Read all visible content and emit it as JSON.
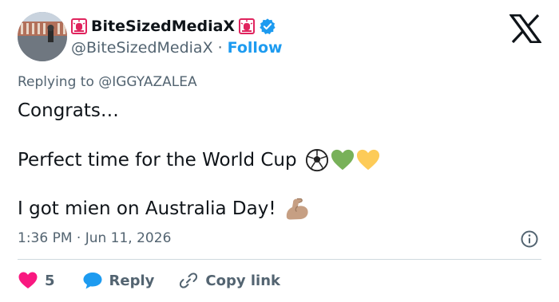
{
  "author": {
    "display_name": "BiteSizedMediaX",
    "handle": "@BiteSizedMediaX",
    "separator": "·",
    "follow_label": "Follow",
    "verified_color": "#1d9bf0"
  },
  "icons": {
    "brand": "x-logo-icon",
    "name_decoration": "siren-icon",
    "verified": "verified-badge-icon",
    "info": "info-icon",
    "like": "heart-icon",
    "reply": "speech-bubble-icon",
    "copy": "link-icon"
  },
  "tweet": {
    "replying_prefix": "Replying to",
    "replying_to": "@IGGYAZALEA",
    "line1": "Congrats…",
    "line2": "Perfect time for the World Cup",
    "line3": "I got mien on Australia Day!",
    "line2_emoji": [
      "soccer-ball",
      "green-heart",
      "yellow-heart"
    ],
    "line3_emoji": [
      "flexed-biceps"
    ],
    "timestamp": "1:36 PM · Jun 11, 2026"
  },
  "actions": {
    "like_count": "5",
    "reply_label": "Reply",
    "copy_label": "Copy link"
  },
  "colors": {
    "text": "#0f1419",
    "secondary": "#536471",
    "accent": "#1d9bf0",
    "like": "#f91880",
    "divider": "#cfd9de"
  }
}
